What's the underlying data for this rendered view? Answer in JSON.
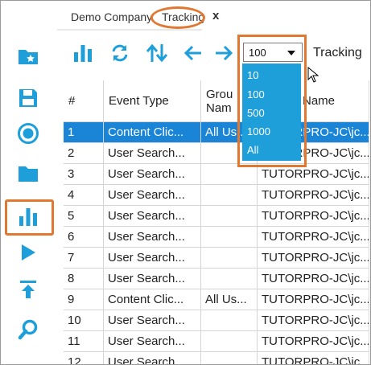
{
  "tabs": {
    "company": "Demo Company",
    "tracking": "Tracking",
    "close": "x"
  },
  "toolbar": {
    "page_size_selected": "100",
    "view_label": "Tracking",
    "page_size_options": [
      "10",
      "100",
      "500",
      "1000",
      "All"
    ]
  },
  "sidebar": {
    "icons": [
      "folder-star-icon",
      "save-icon",
      "record-icon",
      "folder-icon",
      "chart-icon",
      "play-icon",
      "upload-icon",
      "search-icon"
    ],
    "active": "chart-icon"
  },
  "table": {
    "headers": [
      "#",
      "Event Type",
      "Group Name",
      "User Name"
    ],
    "header_visible": {
      "group_top": "Grou",
      "group_bottom": "Nam",
      "user_name": "Name"
    },
    "rows": [
      {
        "num": "1",
        "event": "Content Clic...",
        "group": "All Us...",
        "user": "TUTORPRO-JC\\jc..."
      },
      {
        "num": "2",
        "event": "User Search...",
        "group": "",
        "user": "TUTORPRO-JC\\jc..."
      },
      {
        "num": "3",
        "event": "User Search...",
        "group": "",
        "user": "TUTORPRO-JC\\jc..."
      },
      {
        "num": "4",
        "event": "User Search...",
        "group": "",
        "user": "TUTORPRO-JC\\jc..."
      },
      {
        "num": "5",
        "event": "User Search...",
        "group": "",
        "user": "TUTORPRO-JC\\jc..."
      },
      {
        "num": "6",
        "event": "User Search...",
        "group": "",
        "user": "TUTORPRO-JC\\jc..."
      },
      {
        "num": "7",
        "event": "User Search...",
        "group": "",
        "user": "TUTORPRO-JC\\jc..."
      },
      {
        "num": "8",
        "event": "User Search...",
        "group": "",
        "user": "TUTORPRO-JC\\jc..."
      },
      {
        "num": "9",
        "event": "Content Clic...",
        "group": "All Us...",
        "user": "TUTORPRO-JC\\jc..."
      },
      {
        "num": "10",
        "event": "User Search...",
        "group": "",
        "user": "TUTORPRO-JC\\jc..."
      },
      {
        "num": "11",
        "event": "User Search...",
        "group": "",
        "user": "TUTORPRO-JC\\jc..."
      },
      {
        "num": "12",
        "event": "User Search...",
        "group": "",
        "user": "TUTORPRO-JC\\jc..."
      }
    ],
    "selected_row": "1"
  },
  "colors": {
    "accent": "#1e9fd9",
    "highlight": "#e07832",
    "selected_row": "#1a84d6",
    "icon": "#1e9fd9"
  }
}
